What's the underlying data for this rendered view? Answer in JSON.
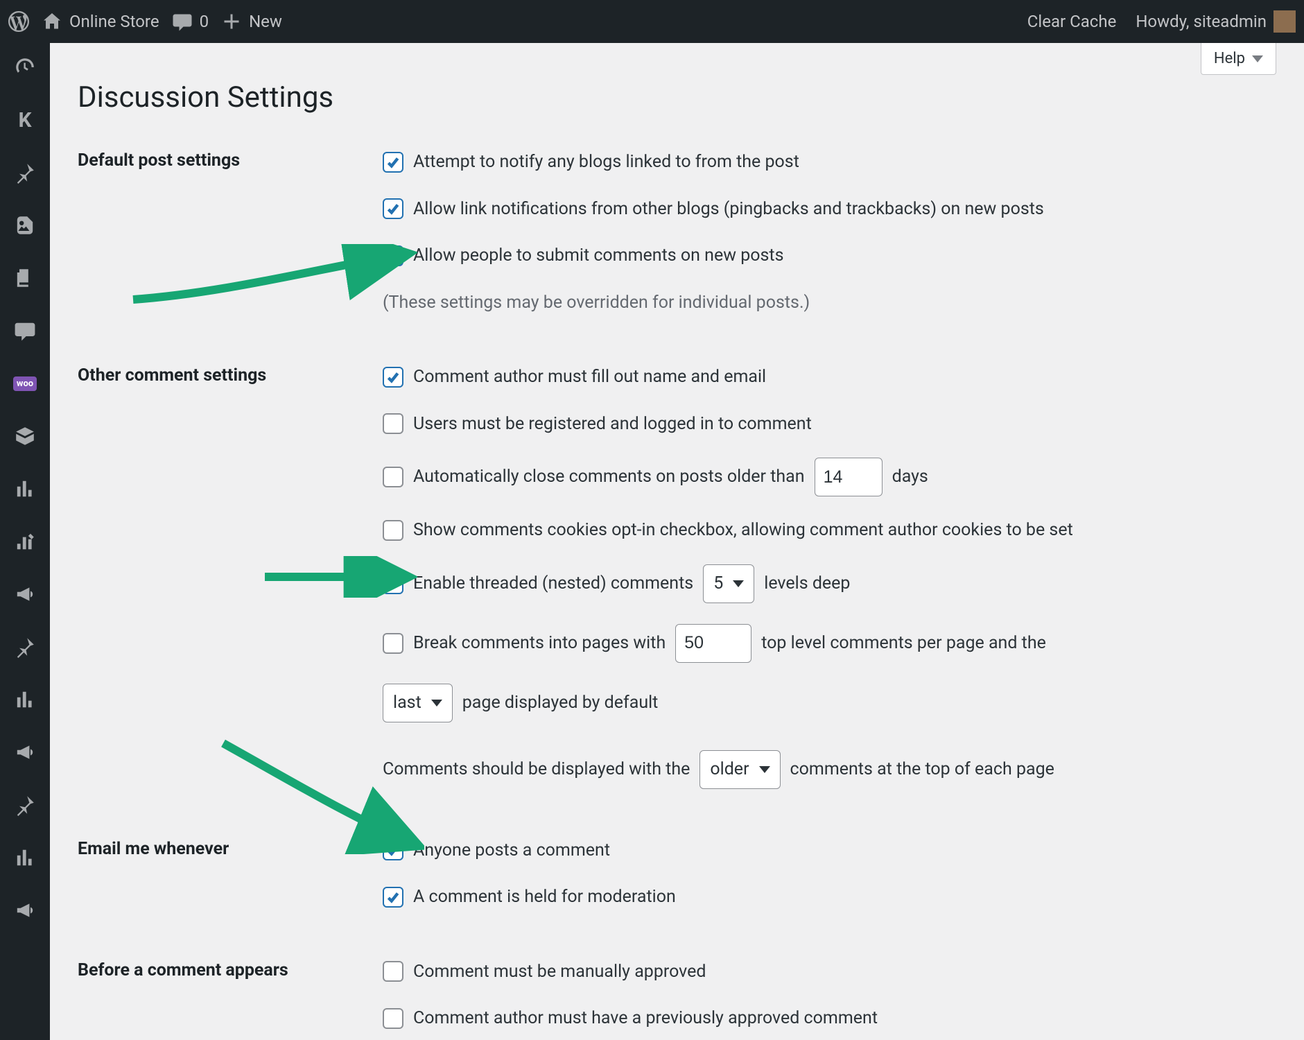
{
  "adminbar": {
    "site_name": "Online Store",
    "comment_count": "0",
    "new_label": "New",
    "clear_cache": "Clear Cache",
    "howdy": "Howdy, siteadmin"
  },
  "help_label": "Help",
  "page_title": "Discussion Settings",
  "sections": {
    "default_post": {
      "heading": "Default post settings",
      "opt1": "Attempt to notify any blogs linked to from the post",
      "opt2": "Allow link notifications from other blogs (pingbacks and trackbacks) on new posts",
      "opt3": "Allow people to submit comments on new posts",
      "note": "(These settings may be overridden for individual posts.)"
    },
    "other": {
      "heading": "Other comment settings",
      "opt1": "Comment author must fill out name and email",
      "opt2": "Users must be registered and logged in to comment",
      "opt3_pre": "Automatically close comments on posts older than",
      "opt3_days_value": "14",
      "opt3_post": "days",
      "opt4": "Show comments cookies opt-in checkbox, allowing comment author cookies to be set",
      "opt5_pre": "Enable threaded (nested) comments",
      "opt5_levels_value": "5",
      "opt5_post": "levels deep",
      "opt6_pre": "Break comments into pages with",
      "opt6_perpage_value": "50",
      "opt6_mid": "top level comments per page and the",
      "opt6_page_sel": "last",
      "opt6_post": "page displayed by default",
      "opt7_pre": "Comments should be displayed with the",
      "opt7_order_sel": "older",
      "opt7_post": "comments at the top of each page"
    },
    "email": {
      "heading": "Email me whenever",
      "opt1": "Anyone posts a comment",
      "opt2": "A comment is held for moderation"
    },
    "before": {
      "heading": "Before a comment appears",
      "opt1": "Comment must be manually approved",
      "opt2": "Comment author must have a previously approved comment"
    }
  }
}
